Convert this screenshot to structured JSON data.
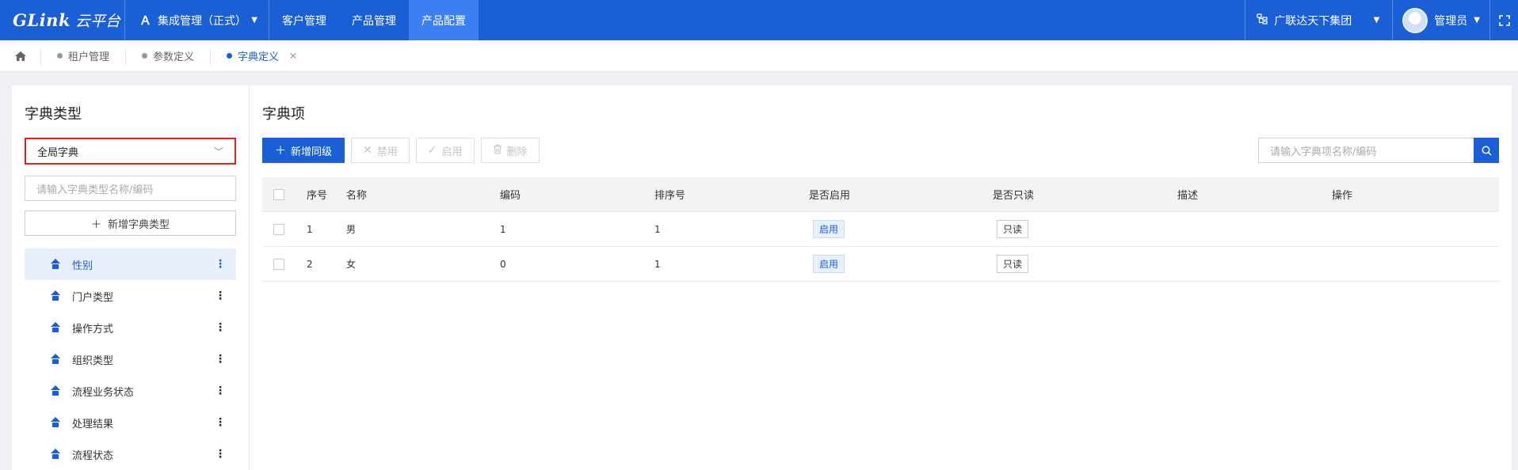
{
  "header": {
    "brand": "GLink",
    "brand_sub": "云平台",
    "system_name": "集成管理（正式）",
    "menu": [
      {
        "label": "客户管理"
      },
      {
        "label": "产品管理"
      },
      {
        "label": "产品配置"
      }
    ],
    "org_name": "广联达天下集团",
    "user_name": "管理员"
  },
  "tabs": [
    {
      "label": "租户管理"
    },
    {
      "label": "参数定义"
    },
    {
      "label": "字典定义"
    }
  ],
  "left_panel": {
    "title": "字典类型",
    "scope_select": "全局字典",
    "search_placeholder": "请输入字典类型名称/编码",
    "add_button": "新增字典类型",
    "items": [
      {
        "label": "性别"
      },
      {
        "label": "门户类型"
      },
      {
        "label": "操作方式"
      },
      {
        "label": "组织类型"
      },
      {
        "label": "流程业务状态"
      },
      {
        "label": "处理结果"
      },
      {
        "label": "流程状态"
      }
    ]
  },
  "right_panel": {
    "title": "字典项",
    "buttons": {
      "add_sibling": "新增同级",
      "disable": "禁用",
      "enable": "启用",
      "delete": "删除"
    },
    "search_placeholder": "请输入字典项名称/编码",
    "columns": [
      "序号",
      "名称",
      "编码",
      "排序号",
      "是否启用",
      "是否只读",
      "描述",
      "操作"
    ],
    "rows": [
      {
        "no": "1",
        "name": "男",
        "code": "1",
        "sort": "1",
        "enabled": "启用",
        "readonly": "只读",
        "desc": "",
        "op": ""
      },
      {
        "no": "2",
        "name": "女",
        "code": "0",
        "sort": "1",
        "enabled": "启用",
        "readonly": "只读",
        "desc": "",
        "op": ""
      }
    ]
  },
  "colors": {
    "primary": "#1a5fd6",
    "highlight_border": "#e02020"
  }
}
